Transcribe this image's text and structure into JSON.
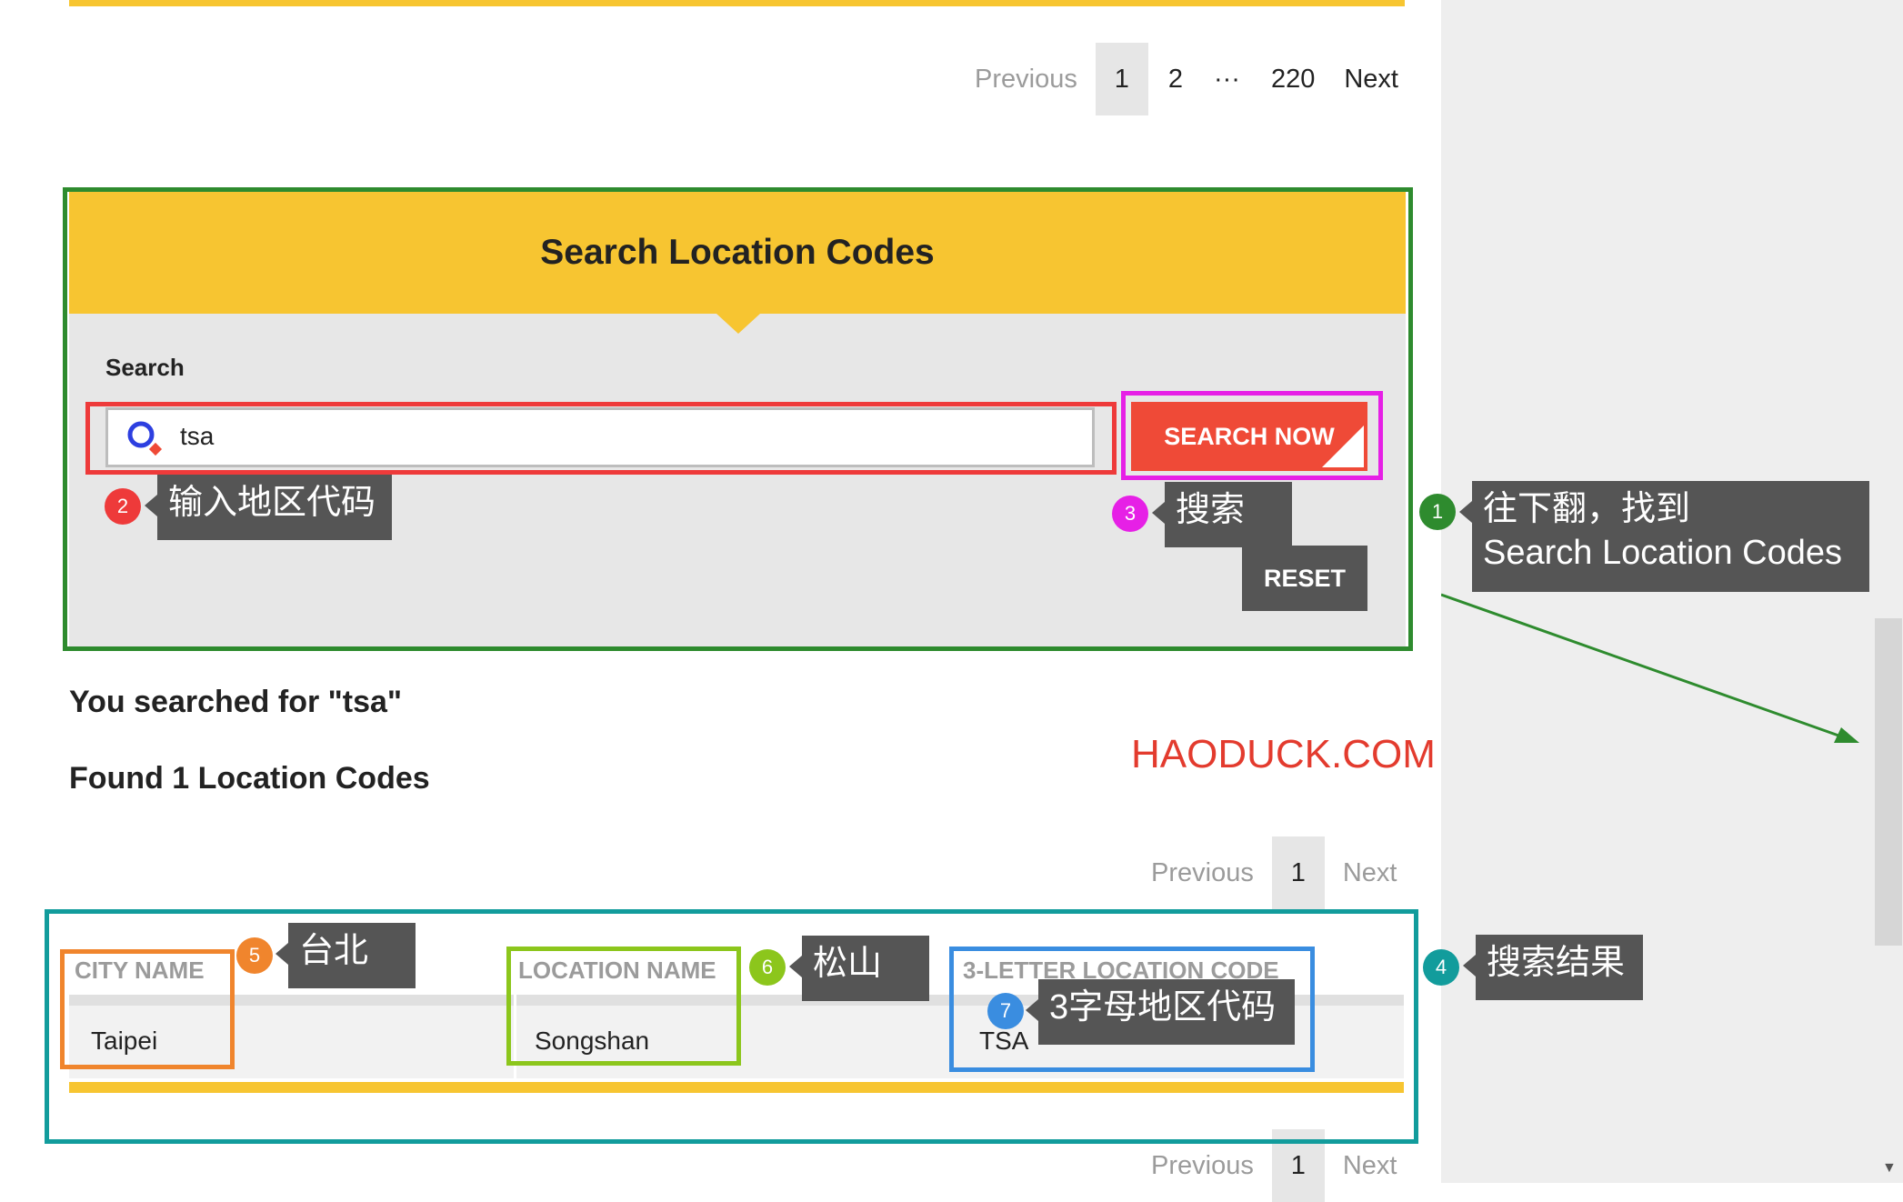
{
  "top_pagination": {
    "previous": "Previous",
    "pages": [
      "1",
      "2",
      "···",
      "220"
    ],
    "active_page": "1",
    "next": "Next"
  },
  "location_search": {
    "title": "Search Location Codes",
    "search_label": "Search",
    "search_value": "tsa",
    "search_button": "SEARCH NOW",
    "reset_button": "RESET"
  },
  "results": {
    "searched_for": "You searched for \"tsa\"",
    "found_count": "Found 1 Location Codes",
    "pagination": {
      "previous": "Previous",
      "page": "1",
      "next": "Next"
    },
    "columns": [
      "CITY NAME",
      "LOCATION NAME",
      "3-LETTER LOCATION CODE"
    ],
    "rows": [
      {
        "city": "Taipei",
        "location": "Songshan",
        "code": "TSA"
      }
    ],
    "bottom_pagination": {
      "previous": "Previous",
      "page": "1",
      "next": "Next"
    }
  },
  "watermark": "HAODUCK.COM",
  "annotations": [
    {
      "number": "1",
      "text_line1": "往下翻，找到",
      "text_line2": "Search Location Codes",
      "color": "#2e8b2e"
    },
    {
      "number": "2",
      "text": "输入地区代码",
      "color": "#ee3a3a"
    },
    {
      "number": "3",
      "text": "搜索",
      "color": "#e620e6"
    },
    {
      "number": "4",
      "text": "搜索结果",
      "color": "#129c9c"
    },
    {
      "number": "5",
      "text": "台北",
      "color": "#f0852d"
    },
    {
      "number": "6",
      "text": "松山",
      "color": "#8cc61c"
    },
    {
      "number": "7",
      "text": "3字母地区代码",
      "color": "#3a8de0"
    }
  ],
  "colors": {
    "brand_yellow": "#f7c531",
    "search_button": "#ef4a37",
    "reset_button": "#555555",
    "watermark": "#e33b2e"
  },
  "icons": [
    "search-icon",
    "corner-triangle-icon",
    "scroll-down-arrow-icon"
  ]
}
